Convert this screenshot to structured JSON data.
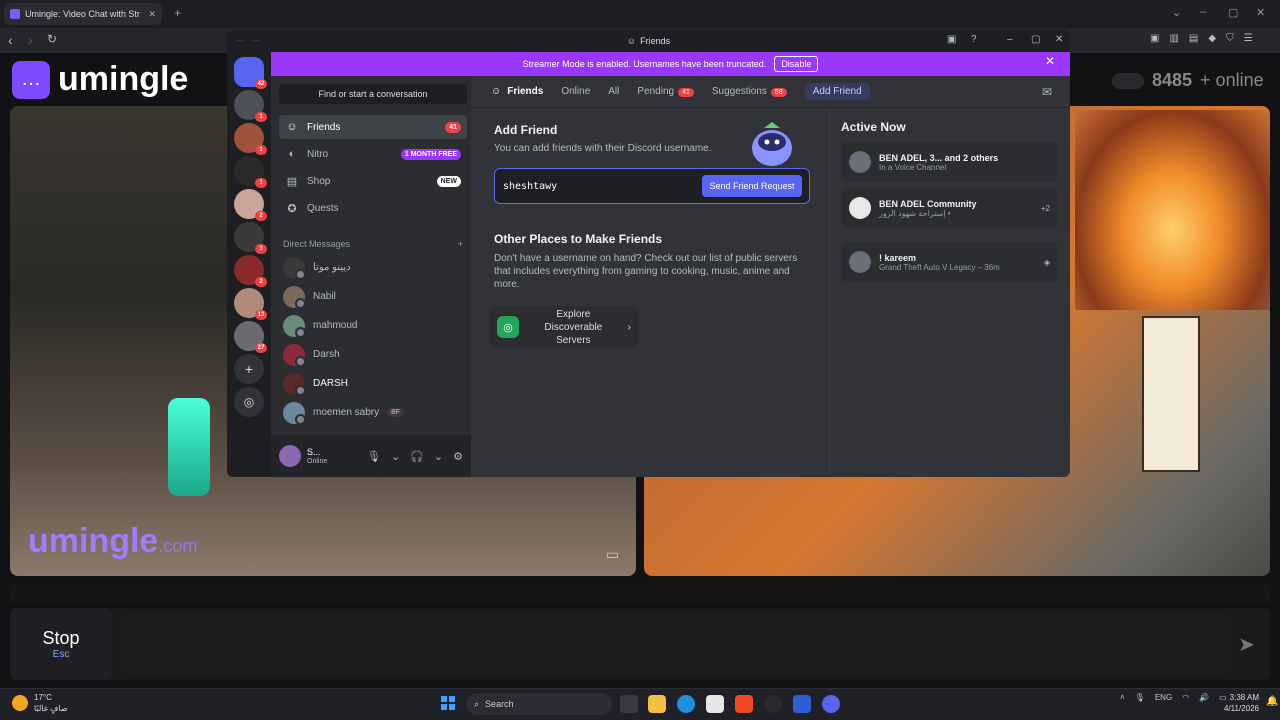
{
  "browser": {
    "tab_title": "Umingle: Video Chat with Str",
    "new_tab": "+"
  },
  "site": {
    "logo_text": "umingle",
    "online_count": "8485",
    "online_label": "+ online",
    "watermark": "umingle",
    "watermark_suffix": ".com",
    "stop_label": "Stop",
    "stop_key": "Esc"
  },
  "discord": {
    "window_title": "Friends",
    "banner_text": "Streamer Mode is enabled. Usernames have been truncated.",
    "banner_button": "Disable",
    "find_conversation": "Find or start a conversation",
    "nav": [
      {
        "label": "Friends",
        "badge": "41"
      },
      {
        "label": "Nitro",
        "badge": "1 MONTH FREE"
      },
      {
        "label": "Shop",
        "badge": "NEW"
      },
      {
        "label": "Quests",
        "badge": ""
      }
    ],
    "dm_header": "Direct Messages",
    "dm_add": "+",
    "dms": [
      {
        "name": "ديينو موتا"
      },
      {
        "name": "Nabil"
      },
      {
        "name": "mahmoud"
      },
      {
        "name": "Darsh"
      },
      {
        "name": "DARSH"
      },
      {
        "name": "moemen sabry",
        "tag": "BF"
      }
    ],
    "user": {
      "name": "S...",
      "status": "Online"
    },
    "guild_badges": [
      "42",
      "1",
      "1",
      "1",
      "2",
      "3",
      "2",
      "13",
      "27"
    ],
    "topnav": {
      "friends": "Friends",
      "online": "Online",
      "all": "All",
      "pending": "Pending",
      "pending_count": "41",
      "suggestions": "Suggestions",
      "suggestions_count": "58",
      "add_friend": "Add Friend"
    },
    "add_friend": {
      "title": "Add Friend",
      "subtitle": "You can add friends with their Discord username.",
      "input_value": "sheshtawy",
      "button": "Send Friend Request"
    },
    "other_places": {
      "title": "Other Places to Make Friends",
      "desc": "Don't have a username on hand? Check out our list of public servers that includes everything from gaming to cooking, music, anime and more.",
      "explore": "Explore Discoverable Servers"
    },
    "active_now": {
      "title": "Active Now",
      "cards": [
        {
          "line1": "BEN ADEL, 3... and 2 others",
          "line2": "In a Voice Channel",
          "extra": ""
        },
        {
          "line1": "BEN ADEL Community",
          "line2": "إستراحة شهود الزور •",
          "extra": "+2"
        },
        {
          "line1": "! kareem",
          "line2": "Grand Theft Auto V Legacy – 36m",
          "extra": ""
        }
      ]
    }
  },
  "taskbar": {
    "temp": "17°C",
    "weather_text": "صافٍ غالبًا",
    "search": "Search",
    "lang": "ENG",
    "time": "3:38 AM",
    "date": "4/11/2026"
  },
  "colors": {
    "discord_blurple": "#5865f2",
    "banner_purple": "#9a37ff",
    "umingle_purple": "#7c4dff"
  }
}
